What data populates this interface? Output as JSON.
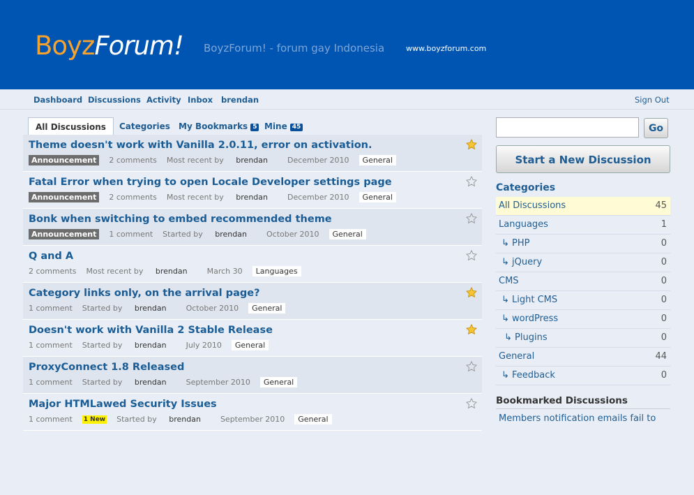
{
  "header": {
    "logo_part1": "Boyz",
    "logo_part2": "Forum!",
    "tagline": "BoyzForum! - forum gay Indonesia",
    "url": "www.boyzforum.com"
  },
  "menu": {
    "items": [
      "Dashboard",
      "Discussions",
      "Activity",
      "Inbox",
      "brendan"
    ],
    "signout": "Sign Out"
  },
  "tabs": [
    {
      "label": "All Discussions"
    },
    {
      "label": "Categories"
    },
    {
      "label": "My Bookmarks",
      "count": "5"
    },
    {
      "label": "Mine",
      "count": "45"
    }
  ],
  "discussions": [
    {
      "title": "Theme doesn't work with Vanilla 2.0.11, error on activation.",
      "announcement": "Announcement",
      "comments": "2 comments",
      "recent_label": "Most recent by",
      "user": "brendan",
      "date": "December 2010",
      "category": "General",
      "starred": true
    },
    {
      "title": "Fatal Error when trying to open Locale Developer settings page",
      "announcement": "Announcement",
      "comments": "2 comments",
      "recent_label": "Most recent by",
      "user": "brendan",
      "date": "December 2010",
      "category": "General",
      "starred": false
    },
    {
      "title": "Bonk when switching to embed recommended theme",
      "announcement": "Announcement",
      "comments": "1 comment",
      "recent_label": "Started by",
      "user": "brendan",
      "date": "October 2010",
      "category": "General",
      "starred": false
    },
    {
      "title": "Q and A",
      "comments": "2 comments",
      "recent_label": "Most recent by",
      "user": "brendan",
      "date": "March 30",
      "category": "Languages",
      "starred": false
    },
    {
      "title": "Category links only, on the arrival page?",
      "comments": "1 comment",
      "recent_label": "Started by",
      "user": "brendan",
      "date": "October 2010",
      "category": "General",
      "starred": true
    },
    {
      "title": "Doesn't work with Vanilla 2 Stable Release",
      "comments": "1 comment",
      "recent_label": "Started by",
      "user": "brendan",
      "date": "July 2010",
      "category": "General",
      "starred": true
    },
    {
      "title": "ProxyConnect 1.8 Released",
      "comments": "1 comment",
      "recent_label": "Started by",
      "user": "brendan",
      "date": "September 2010",
      "category": "General",
      "starred": false
    },
    {
      "title": "Major HTMLawed Security Issues",
      "comments": "1 comment",
      "new_badge": "1 New",
      "recent_label": "Started by",
      "user": "brendan",
      "date": "September 2010",
      "category": "General",
      "starred": false
    }
  ],
  "sidebar": {
    "search_value": "",
    "go_label": "Go",
    "new_discussion_label": "Start a New Discussion",
    "categories_heading": "Categories",
    "categories": [
      {
        "name": "All Discussions",
        "count": "45",
        "depth": 0
      },
      {
        "name": "Languages",
        "count": "1",
        "depth": 0
      },
      {
        "name": "↳ PHP",
        "count": "0",
        "depth": 1
      },
      {
        "name": "↳ jQuery",
        "count": "0",
        "depth": 1
      },
      {
        "name": "CMS",
        "count": "0",
        "depth": 0
      },
      {
        "name": "↳ Light CMS",
        "count": "0",
        "depth": 1
      },
      {
        "name": "↳ wordPress",
        "count": "0",
        "depth": 1
      },
      {
        "name": "↳ Plugins",
        "count": "0",
        "depth": 2
      },
      {
        "name": "General",
        "count": "44",
        "depth": 0
      },
      {
        "name": "↳ Feedback",
        "count": "0",
        "depth": 1
      }
    ],
    "bookmarked_heading": "Bookmarked Discussions",
    "bookmarked_items": [
      "Members notification emails fail to"
    ]
  },
  "colors": {
    "banner": "#0055b3",
    "logo_accent": "#f5a22f",
    "link": "#1f5d93",
    "star_active": "#f7c531"
  }
}
